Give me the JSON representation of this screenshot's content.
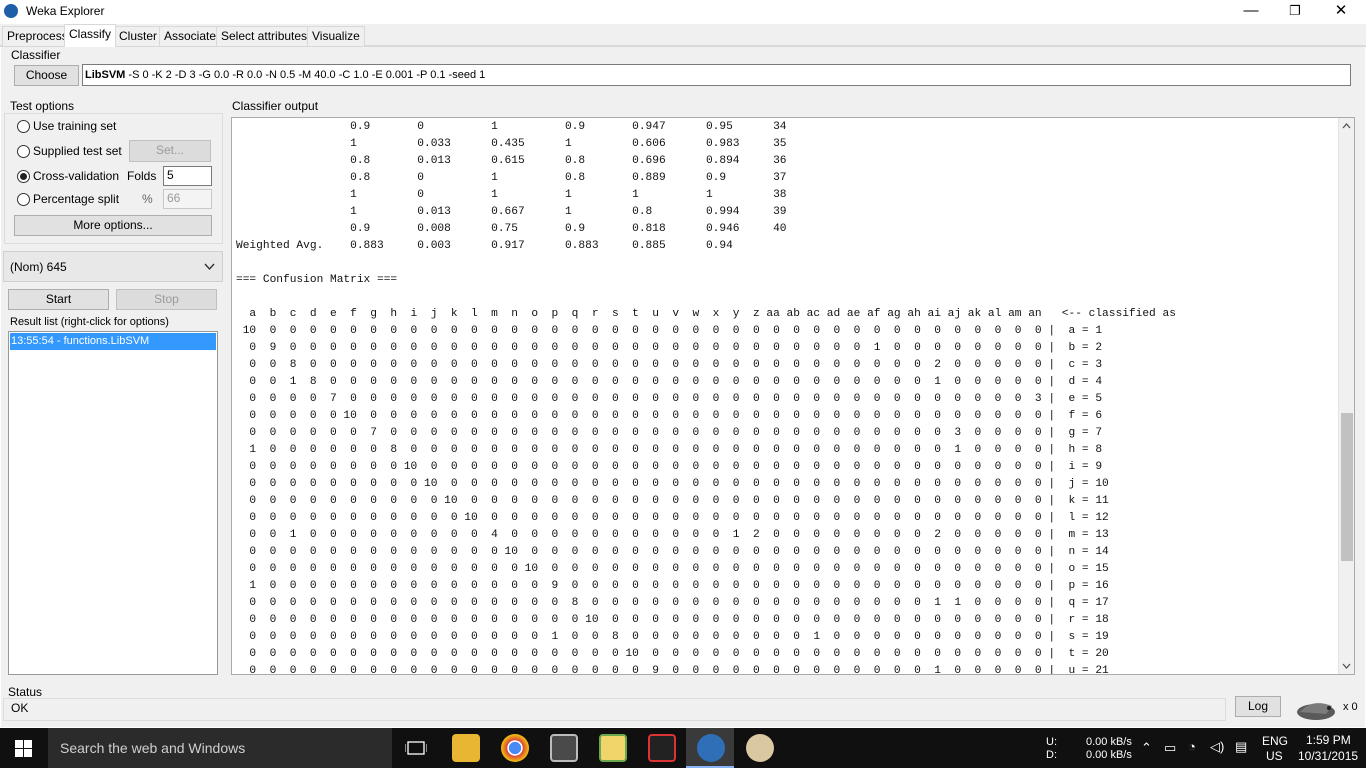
{
  "window": {
    "title": "Weka Explorer",
    "minimize": "—",
    "maximize": "❐",
    "close": "✕"
  },
  "tabs": [
    "Preprocess",
    "Classify",
    "Cluster",
    "Associate",
    "Select attributes",
    "Visualize"
  ],
  "active_tab": "Classify",
  "classifier": {
    "group_label": "Classifier",
    "choose_label": "Choose",
    "name": "LibSVM",
    "options": " -S 0 -K 2 -D 3 -G 0.0 -R 0.0 -N 0.5 -M 40.0 -C 1.0 -E 0.001 -P 0.1 -seed 1"
  },
  "test_options": {
    "group_label": "Test options",
    "use_training": "Use training set",
    "supplied_test": "Supplied test set",
    "set_button": "Set...",
    "cross_validation": "Cross-validation",
    "folds_label": "Folds",
    "folds_value": "5",
    "percentage_split": "Percentage split",
    "percent_symbol": "%",
    "percent_value": "66",
    "more_options": "More options...",
    "selected": "Cross-validation"
  },
  "class_select": {
    "value": "(Nom) 645"
  },
  "actions": {
    "start": "Start",
    "stop": "Stop"
  },
  "result_list": {
    "label": "Result list (right-click for options)",
    "items": [
      "13:55:54 - functions.LibSVM"
    ]
  },
  "output": {
    "label": "Classifier output",
    "text": "                 0.9       0          1          0.9       0.947      0.95      34\n                 1         0.033      0.435      1         0.606      0.983     35\n                 0.8       0.013      0.615      0.8       0.696      0.894     36\n                 0.8       0          1          0.8       0.889      0.9       37\n                 1         0          1          1         1          1         38\n                 1         0.013      0.667      1         0.8        0.994     39\n                 0.9       0.008      0.75       0.9       0.818      0.946     40\nWeighted Avg.    0.883     0.003      0.917      0.883     0.885      0.94\n\n=== Confusion Matrix ===\n\n  a  b  c  d  e  f  g  h  i  j  k  l  m  n  o  p  q  r  s  t  u  v  w  x  y  z aa ab ac ad ae af ag ah ai aj ak al am an   <-- classified as\n 10  0  0  0  0  0  0  0  0  0  0  0  0  0  0  0  0  0  0  0  0  0  0  0  0  0  0  0  0  0  0  0  0  0  0  0  0  0  0  0 |  a = 1\n  0  9  0  0  0  0  0  0  0  0  0  0  0  0  0  0  0  0  0  0  0  0  0  0  0  0  0  0  0  0  0  1  0  0  0  0  0  0  0  0 |  b = 2\n  0  0  8  0  0  0  0  0  0  0  0  0  0  0  0  0  0  0  0  0  0  0  0  0  0  0  0  0  0  0  0  0  0  0  2  0  0  0  0  0 |  c = 3\n  0  0  1  8  0  0  0  0  0  0  0  0  0  0  0  0  0  0  0  0  0  0  0  0  0  0  0  0  0  0  0  0  0  0  1  0  0  0  0  0 |  d = 4\n  0  0  0  0  7  0  0  0  0  0  0  0  0  0  0  0  0  0  0  0  0  0  0  0  0  0  0  0  0  0  0  0  0  0  0  0  0  0  0  3 |  e = 5\n  0  0  0  0  0 10  0  0  0  0  0  0  0  0  0  0  0  0  0  0  0  0  0  0  0  0  0  0  0  0  0  0  0  0  0  0  0  0  0  0 |  f = 6\n  0  0  0  0  0  0  7  0  0  0  0  0  0  0  0  0  0  0  0  0  0  0  0  0  0  0  0  0  0  0  0  0  0  0  0  3  0  0  0  0 |  g = 7\n  1  0  0  0  0  0  0  8  0  0  0  0  0  0  0  0  0  0  0  0  0  0  0  0  0  0  0  0  0  0  0  0  0  0  0  1  0  0  0  0 |  h = 8\n  0  0  0  0  0  0  0  0 10  0  0  0  0  0  0  0  0  0  0  0  0  0  0  0  0  0  0  0  0  0  0  0  0  0  0  0  0  0  0  0 |  i = 9\n  0  0  0  0  0  0  0  0  0 10  0  0  0  0  0  0  0  0  0  0  0  0  0  0  0  0  0  0  0  0  0  0  0  0  0  0  0  0  0  0 |  j = 10\n  0  0  0  0  0  0  0  0  0  0 10  0  0  0  0  0  0  0  0  0  0  0  0  0  0  0  0  0  0  0  0  0  0  0  0  0  0  0  0  0 |  k = 11\n  0  0  0  0  0  0  0  0  0  0  0 10  0  0  0  0  0  0  0  0  0  0  0  0  0  0  0  0  0  0  0  0  0  0  0  0  0  0  0  0 |  l = 12\n  0  0  1  0  0  0  0  0  0  0  0  0  4  0  0  0  0  0  0  0  0  0  0  0  1  2  0  0  0  0  0  0  0  0  2  0  0  0  0  0 |  m = 13\n  0  0  0  0  0  0  0  0  0  0  0  0  0 10  0  0  0  0  0  0  0  0  0  0  0  0  0  0  0  0  0  0  0  0  0  0  0  0  0  0 |  n = 14\n  0  0  0  0  0  0  0  0  0  0  0  0  0  0 10  0  0  0  0  0  0  0  0  0  0  0  0  0  0  0  0  0  0  0  0  0  0  0  0  0 |  o = 15\n  1  0  0  0  0  0  0  0  0  0  0  0  0  0  0  9  0  0  0  0  0  0  0  0  0  0  0  0  0  0  0  0  0  0  0  0  0  0  0  0 |  p = 16\n  0  0  0  0  0  0  0  0  0  0  0  0  0  0  0  0  8  0  0  0  0  0  0  0  0  0  0  0  0  0  0  0  0  0  1  1  0  0  0  0 |  q = 17\n  0  0  0  0  0  0  0  0  0  0  0  0  0  0  0  0  0 10  0  0  0  0  0  0  0  0  0  0  0  0  0  0  0  0  0  0  0  0  0  0 |  r = 18\n  0  0  0  0  0  0  0  0  0  0  0  0  0  0  0  1  0  0  8  0  0  0  0  0  0  0  0  0  1  0  0  0  0  0  0  0  0  0  0  0 |  s = 19\n  0  0  0  0  0  0  0  0  0  0  0  0  0  0  0  0  0  0  0 10  0  0  0  0  0  0  0  0  0  0  0  0  0  0  0  0  0  0  0  0 |  t = 20\n  0  0  0  0  0  0  0  0  0  0  0  0  0  0  0  0  0  0  0  0  9  0  0  0  0  0  0  0  0  0  0  0  0  0  1  0  0  0  0  0 |  u = 21"
  },
  "status": {
    "label": "Status",
    "value": "OK",
    "log_button": "Log",
    "count": "x 0"
  },
  "taskbar": {
    "search_placeholder": "Search the web and Windows",
    "net_u_label": "U:",
    "net_d_label": "D:",
    "net_u": "0.00 kB/s",
    "net_d": "0.00 kB/s",
    "lang": "ENG",
    "region": "US",
    "time": "1:59 PM",
    "date": "10/31/2015"
  }
}
